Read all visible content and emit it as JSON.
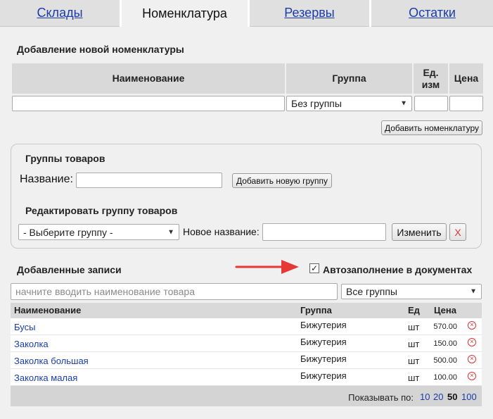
{
  "tabs": [
    {
      "label": "Склады"
    },
    {
      "label": "Номенклатура"
    },
    {
      "label": "Резервы"
    },
    {
      "label": "Остатки"
    }
  ],
  "add_nomenclature": {
    "title": "Добавление новой номенклатуры",
    "col_name": "Наименование",
    "col_group": "Группа",
    "col_unit": "Ед. изм",
    "col_price": "Цена",
    "group_value": "Без группы",
    "add_button": "Добавить номенклатуру"
  },
  "groups_panel": {
    "title": "Группы товаров",
    "name_label": "Название:",
    "add_group_button": "Добавить новую группу",
    "edit_title": "Редактировать группу товаров",
    "select_value": "- Выберите группу -",
    "new_name_label": "Новое название:",
    "change_button": "Изменить",
    "delete_button": "X"
  },
  "records": {
    "title": "Добавленные записи",
    "autofill_label": "Автозаполнение в документах",
    "autofill_checked": true,
    "search_placeholder": "начните вводить наименование товара",
    "group_filter": "Все группы",
    "headers": {
      "name": "Наименование",
      "group": "Группа",
      "unit": "Ед",
      "price": "Цена"
    },
    "rows": [
      {
        "name": "Бусы",
        "group": "Бижутерия",
        "unit": "шт",
        "price": "570.00"
      },
      {
        "name": "Заколка",
        "group": "Бижутерия",
        "unit": "шт",
        "price": "150.00"
      },
      {
        "name": "Заколка большая",
        "group": "Бижутерия",
        "unit": "шт",
        "price": "500.00"
      },
      {
        "name": "Заколка малая",
        "group": "Бижутерия",
        "unit": "шт",
        "price": "100.00"
      }
    ],
    "show_per_page_label": "Показывать по:",
    "page_sizes": [
      "10",
      "20",
      "50",
      "100"
    ],
    "current_page_size": "50"
  },
  "colors": {
    "link": "#1a3ca8",
    "delete": "#dd3333",
    "arrow": "#e53935"
  }
}
